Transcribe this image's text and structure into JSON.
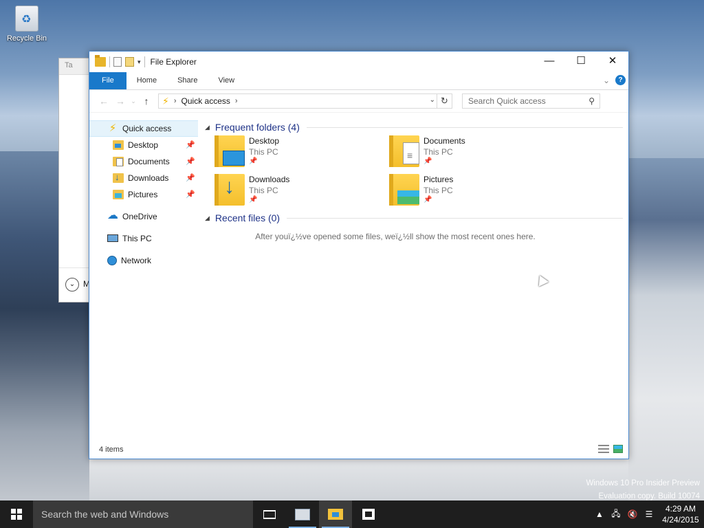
{
  "desktop": {
    "recycle_bin_label": "Recycle Bin",
    "watermark_line1": "Windows 10 Pro Insider Preview",
    "watermark_line2": "Evaluation copy. Build 10074"
  },
  "behind_window": {
    "title_partial": "Ta",
    "footer_partial": "M"
  },
  "window": {
    "title": "File Explorer",
    "controls": {
      "minimize": "—",
      "maximize": "☐",
      "close": "✕"
    },
    "ribbon_tabs": [
      "File",
      "Home",
      "Share",
      "View"
    ],
    "address": {
      "location": "Quick access"
    },
    "search": {
      "placeholder": "Search Quick access"
    },
    "nav_pane": {
      "quick_access": "Quick access",
      "pinned": [
        "Desktop",
        "Documents",
        "Downloads",
        "Pictures"
      ],
      "onedrive": "OneDrive",
      "this_pc": "This PC",
      "network": "Network"
    },
    "frequent": {
      "header": "Frequent folders (4)",
      "items": [
        {
          "name": "Desktop",
          "location": "This PC"
        },
        {
          "name": "Documents",
          "location": "This PC"
        },
        {
          "name": "Downloads",
          "location": "This PC"
        },
        {
          "name": "Pictures",
          "location": "This PC"
        }
      ]
    },
    "recent": {
      "header": "Recent files (0)",
      "empty_message": "After youï¿½ve opened some files, weï¿½ll show the most recent ones here."
    },
    "status": {
      "item_count": "4 items"
    }
  },
  "taskbar": {
    "search_text": "Search the web and Windows",
    "time": "4:29 AM",
    "date": "4/24/2015"
  }
}
